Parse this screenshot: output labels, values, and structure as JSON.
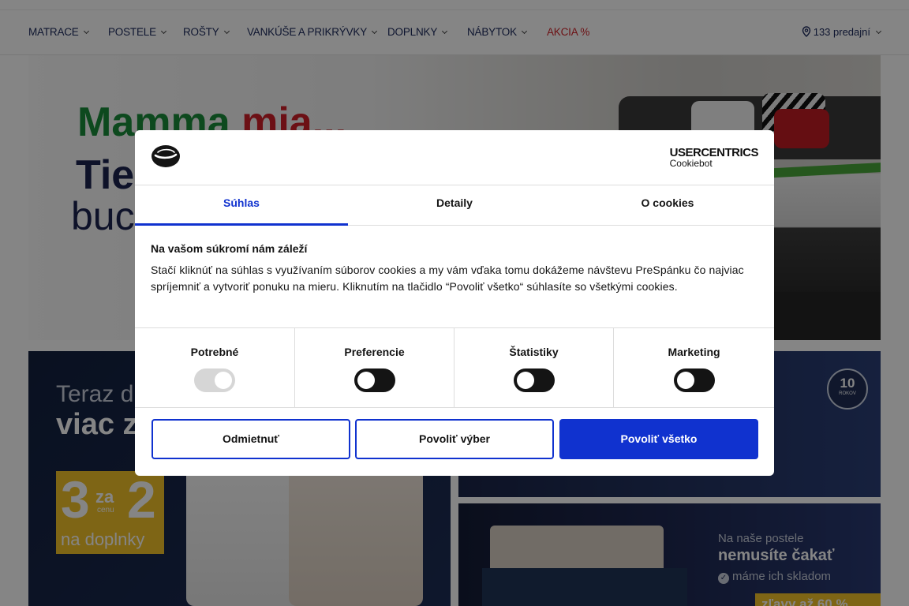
{
  "nav": {
    "items": [
      {
        "label": "MATRACE"
      },
      {
        "label": "POSTELE"
      },
      {
        "label": "ROŠTY"
      },
      {
        "label": "VANKÚŠE A PRIKRÝVKY"
      },
      {
        "label": "DOPLNKY"
      },
      {
        "label": "NÁBYTOK"
      },
      {
        "label": "AKCIA %"
      }
    ],
    "stores": "133 predajní"
  },
  "banners": {
    "hero": {
      "line1_green": "Mamma",
      "line1_red": "mia...",
      "line2": "Tie",
      "line3": "buc"
    },
    "promo_left": {
      "line1": "Teraz d",
      "line2": "viac z",
      "offer_big": "3",
      "offer_za": "za",
      "offer_cenu": "cenu",
      "offer_two": "2",
      "offer_sub": "na doplnky"
    },
    "promo_right_top": {
      "seal_number": "10",
      "seal_text": "ROKOV"
    },
    "promo_right_bottom": {
      "line1": "Na naše postele",
      "line2": "nemusíte čakať",
      "line3": "máme ich skladom",
      "deal": "zľavy až 60 %"
    }
  },
  "cookie_dialog": {
    "brand": "USERCENTRICS",
    "brand_sub": "Cookiebot",
    "tabs": [
      {
        "label": "Súhlas",
        "active": true
      },
      {
        "label": "Detaily",
        "active": false
      },
      {
        "label": "O cookies",
        "active": false
      }
    ],
    "title": "Na vašom súkromí nám záleží",
    "text": "Stačí kliknúť na súhlas s využívaním súborov cookies a my vám vďaka tomu dokážeme návštevu PreSpánku čo najviac spríjemniť a vytvoriť ponuku na mieru. Kliknutím na tlačidlo “Povoliť všetko“ súhlasíte so všetkými cookies.",
    "toggles": [
      {
        "label": "Potrebné",
        "state": "on-disabled"
      },
      {
        "label": "Preferencie",
        "state": "off"
      },
      {
        "label": "Štatistiky",
        "state": "off"
      },
      {
        "label": "Marketing",
        "state": "off"
      }
    ],
    "buttons": {
      "reject": "Odmietnuť",
      "allow_selection": "Povoliť výber",
      "allow_all": "Povoliť všetko"
    },
    "accent_color": "#1032cf"
  }
}
